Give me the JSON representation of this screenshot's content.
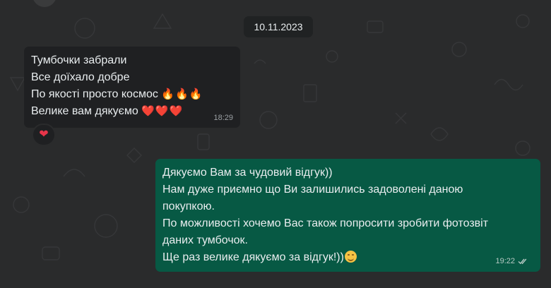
{
  "chat": {
    "date_label": "10.11.2023",
    "incoming": {
      "lines": [
        {
          "text": "Тумбочки забрали",
          "emoji": ""
        },
        {
          "text": "Все доїхало добре",
          "emoji": ""
        },
        {
          "text": "По якості просто космос ",
          "emoji": "🔥🔥🔥"
        },
        {
          "text": "Велике вам дякуємо ",
          "emoji": "❤️❤️❤️"
        }
      ],
      "time": "18:29",
      "reaction": "❤"
    },
    "outgoing": {
      "lines": [
        "Дякуємо Вам за чудовий відгук))",
        "Нам дуже приємно що Ви залишились задоволені даною",
        "покупкою.",
        "По можливості хочемо Вас також попросити зробити фотозвіт",
        "даних тумбочок.",
        "Ще раз велике дякуємо за відгук!))"
      ],
      "trailing_emoji": "smiling-face-icon",
      "time": "19:22",
      "status": "read-double-check"
    }
  },
  "colors": {
    "background": "#2a2b2c",
    "incoming_bubble": "#1f2022",
    "outgoing_bubble": "#075944",
    "text": "#e9edef"
  }
}
